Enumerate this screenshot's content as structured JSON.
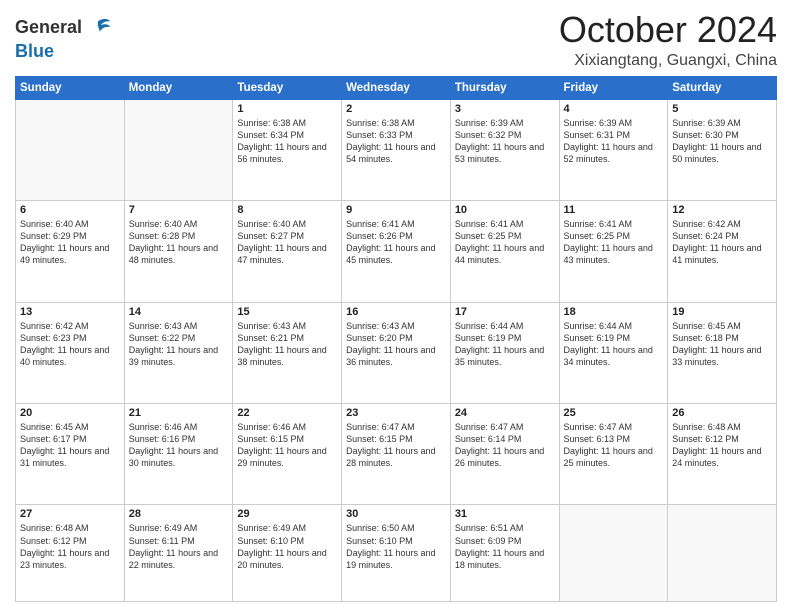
{
  "header": {
    "logo_line1": "General",
    "logo_line2": "Blue",
    "month": "October 2024",
    "location": "Xixiangtang, Guangxi, China"
  },
  "weekdays": [
    "Sunday",
    "Monday",
    "Tuesday",
    "Wednesday",
    "Thursday",
    "Friday",
    "Saturday"
  ],
  "weeks": [
    [
      {
        "day": "",
        "sunrise": "",
        "sunset": "",
        "daylight": ""
      },
      {
        "day": "",
        "sunrise": "",
        "sunset": "",
        "daylight": ""
      },
      {
        "day": "1",
        "sunrise": "Sunrise: 6:38 AM",
        "sunset": "Sunset: 6:34 PM",
        "daylight": "Daylight: 11 hours and 56 minutes."
      },
      {
        "day": "2",
        "sunrise": "Sunrise: 6:38 AM",
        "sunset": "Sunset: 6:33 PM",
        "daylight": "Daylight: 11 hours and 54 minutes."
      },
      {
        "day": "3",
        "sunrise": "Sunrise: 6:39 AM",
        "sunset": "Sunset: 6:32 PM",
        "daylight": "Daylight: 11 hours and 53 minutes."
      },
      {
        "day": "4",
        "sunrise": "Sunrise: 6:39 AM",
        "sunset": "Sunset: 6:31 PM",
        "daylight": "Daylight: 11 hours and 52 minutes."
      },
      {
        "day": "5",
        "sunrise": "Sunrise: 6:39 AM",
        "sunset": "Sunset: 6:30 PM",
        "daylight": "Daylight: 11 hours and 50 minutes."
      }
    ],
    [
      {
        "day": "6",
        "sunrise": "Sunrise: 6:40 AM",
        "sunset": "Sunset: 6:29 PM",
        "daylight": "Daylight: 11 hours and 49 minutes."
      },
      {
        "day": "7",
        "sunrise": "Sunrise: 6:40 AM",
        "sunset": "Sunset: 6:28 PM",
        "daylight": "Daylight: 11 hours and 48 minutes."
      },
      {
        "day": "8",
        "sunrise": "Sunrise: 6:40 AM",
        "sunset": "Sunset: 6:27 PM",
        "daylight": "Daylight: 11 hours and 47 minutes."
      },
      {
        "day": "9",
        "sunrise": "Sunrise: 6:41 AM",
        "sunset": "Sunset: 6:26 PM",
        "daylight": "Daylight: 11 hours and 45 minutes."
      },
      {
        "day": "10",
        "sunrise": "Sunrise: 6:41 AM",
        "sunset": "Sunset: 6:25 PM",
        "daylight": "Daylight: 11 hours and 44 minutes."
      },
      {
        "day": "11",
        "sunrise": "Sunrise: 6:41 AM",
        "sunset": "Sunset: 6:25 PM",
        "daylight": "Daylight: 11 hours and 43 minutes."
      },
      {
        "day": "12",
        "sunrise": "Sunrise: 6:42 AM",
        "sunset": "Sunset: 6:24 PM",
        "daylight": "Daylight: 11 hours and 41 minutes."
      }
    ],
    [
      {
        "day": "13",
        "sunrise": "Sunrise: 6:42 AM",
        "sunset": "Sunset: 6:23 PM",
        "daylight": "Daylight: 11 hours and 40 minutes."
      },
      {
        "day": "14",
        "sunrise": "Sunrise: 6:43 AM",
        "sunset": "Sunset: 6:22 PM",
        "daylight": "Daylight: 11 hours and 39 minutes."
      },
      {
        "day": "15",
        "sunrise": "Sunrise: 6:43 AM",
        "sunset": "Sunset: 6:21 PM",
        "daylight": "Daylight: 11 hours and 38 minutes."
      },
      {
        "day": "16",
        "sunrise": "Sunrise: 6:43 AM",
        "sunset": "Sunset: 6:20 PM",
        "daylight": "Daylight: 11 hours and 36 minutes."
      },
      {
        "day": "17",
        "sunrise": "Sunrise: 6:44 AM",
        "sunset": "Sunset: 6:19 PM",
        "daylight": "Daylight: 11 hours and 35 minutes."
      },
      {
        "day": "18",
        "sunrise": "Sunrise: 6:44 AM",
        "sunset": "Sunset: 6:19 PM",
        "daylight": "Daylight: 11 hours and 34 minutes."
      },
      {
        "day": "19",
        "sunrise": "Sunrise: 6:45 AM",
        "sunset": "Sunset: 6:18 PM",
        "daylight": "Daylight: 11 hours and 33 minutes."
      }
    ],
    [
      {
        "day": "20",
        "sunrise": "Sunrise: 6:45 AM",
        "sunset": "Sunset: 6:17 PM",
        "daylight": "Daylight: 11 hours and 31 minutes."
      },
      {
        "day": "21",
        "sunrise": "Sunrise: 6:46 AM",
        "sunset": "Sunset: 6:16 PM",
        "daylight": "Daylight: 11 hours and 30 minutes."
      },
      {
        "day": "22",
        "sunrise": "Sunrise: 6:46 AM",
        "sunset": "Sunset: 6:15 PM",
        "daylight": "Daylight: 11 hours and 29 minutes."
      },
      {
        "day": "23",
        "sunrise": "Sunrise: 6:47 AM",
        "sunset": "Sunset: 6:15 PM",
        "daylight": "Daylight: 11 hours and 28 minutes."
      },
      {
        "day": "24",
        "sunrise": "Sunrise: 6:47 AM",
        "sunset": "Sunset: 6:14 PM",
        "daylight": "Daylight: 11 hours and 26 minutes."
      },
      {
        "day": "25",
        "sunrise": "Sunrise: 6:47 AM",
        "sunset": "Sunset: 6:13 PM",
        "daylight": "Daylight: 11 hours and 25 minutes."
      },
      {
        "day": "26",
        "sunrise": "Sunrise: 6:48 AM",
        "sunset": "Sunset: 6:12 PM",
        "daylight": "Daylight: 11 hours and 24 minutes."
      }
    ],
    [
      {
        "day": "27",
        "sunrise": "Sunrise: 6:48 AM",
        "sunset": "Sunset: 6:12 PM",
        "daylight": "Daylight: 11 hours and 23 minutes."
      },
      {
        "day": "28",
        "sunrise": "Sunrise: 6:49 AM",
        "sunset": "Sunset: 6:11 PM",
        "daylight": "Daylight: 11 hours and 22 minutes."
      },
      {
        "day": "29",
        "sunrise": "Sunrise: 6:49 AM",
        "sunset": "Sunset: 6:10 PM",
        "daylight": "Daylight: 11 hours and 20 minutes."
      },
      {
        "day": "30",
        "sunrise": "Sunrise: 6:50 AM",
        "sunset": "Sunset: 6:10 PM",
        "daylight": "Daylight: 11 hours and 19 minutes."
      },
      {
        "day": "31",
        "sunrise": "Sunrise: 6:51 AM",
        "sunset": "Sunset: 6:09 PM",
        "daylight": "Daylight: 11 hours and 18 minutes."
      },
      {
        "day": "",
        "sunrise": "",
        "sunset": "",
        "daylight": ""
      },
      {
        "day": "",
        "sunrise": "",
        "sunset": "",
        "daylight": ""
      }
    ]
  ]
}
